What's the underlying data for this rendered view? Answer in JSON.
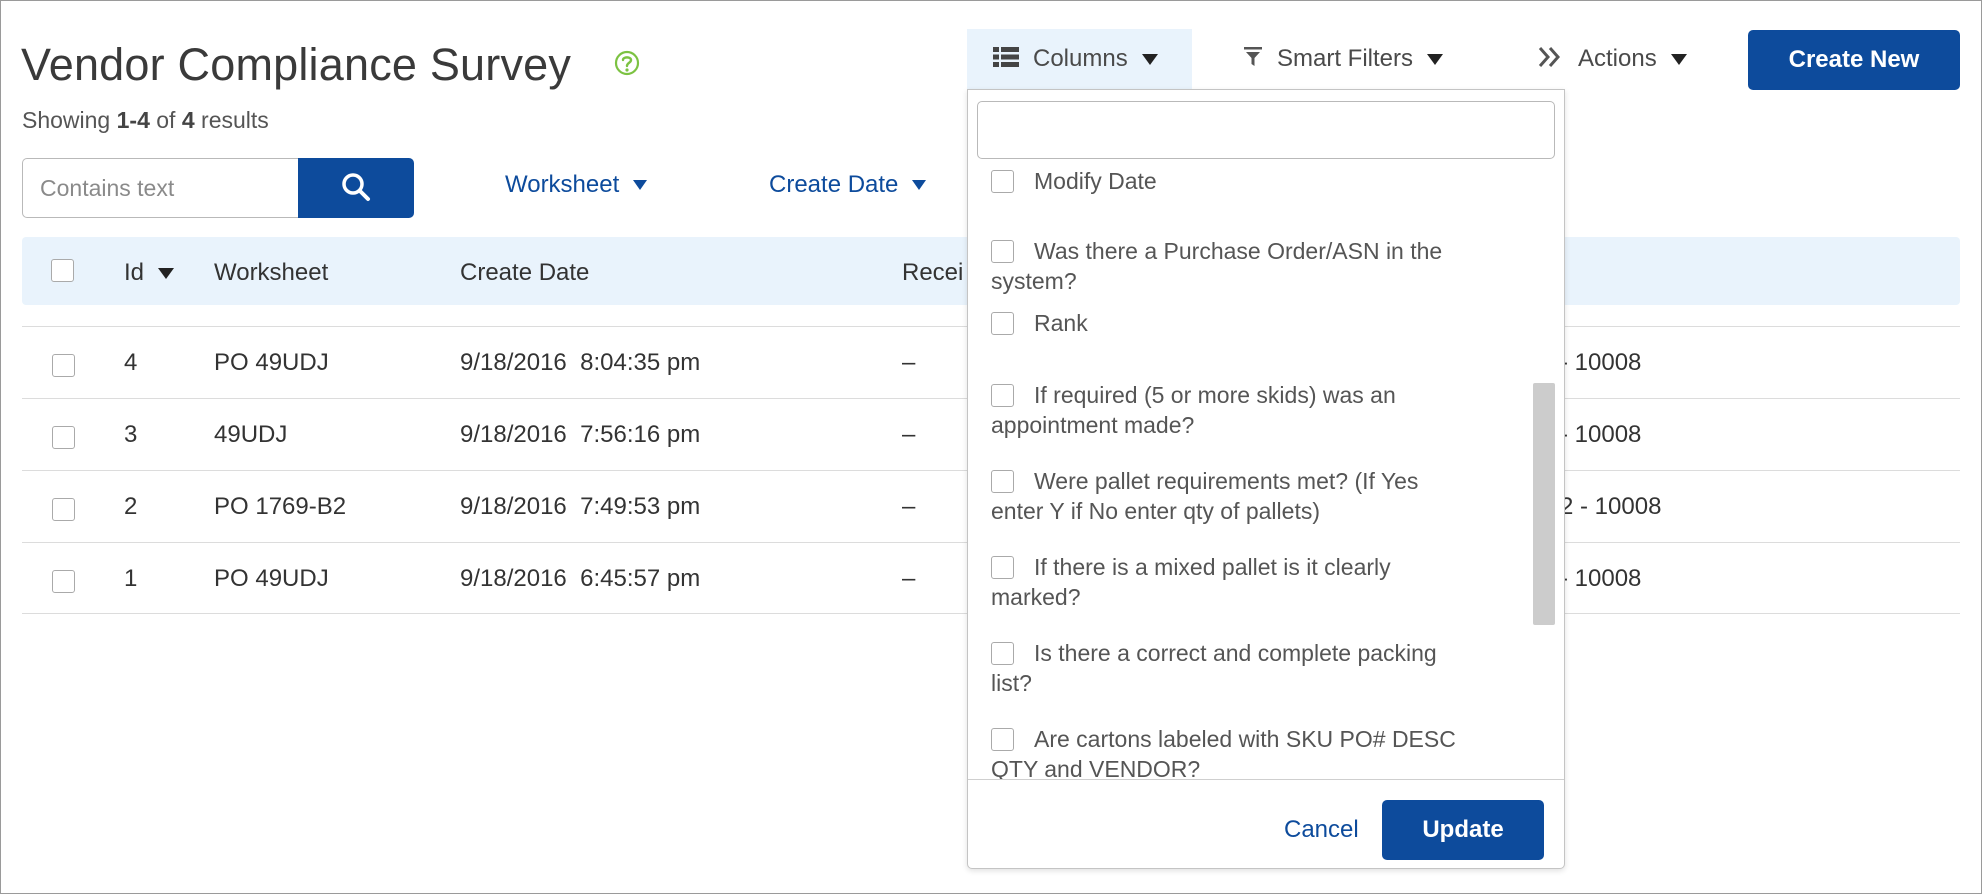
{
  "header": {
    "title": "Vendor Compliance Survey",
    "showing_prefix": "Showing",
    "showing_range": "1-4",
    "showing_of": "of",
    "showing_total": "4",
    "showing_suffix": "results"
  },
  "toolbar": {
    "columns_label": "Columns",
    "smart_filters_label": "Smart Filters",
    "actions_label": "Actions",
    "create_new_label": "Create New"
  },
  "search": {
    "placeholder": "Contains text",
    "value": ""
  },
  "filters": {
    "worksheet_label": "Worksheet",
    "create_date_label": "Create Date"
  },
  "table": {
    "headers": {
      "id": "Id",
      "worksheet": "Worksheet",
      "create_date": "Create Date",
      "received": "Recei"
    },
    "rows": [
      {
        "id": "4",
        "worksheet": "PO 49UDJ",
        "create_date": "9/18/2016  8:04:35 pm",
        "received": "–",
        "right": "- 10008"
      },
      {
        "id": "3",
        "worksheet": "49UDJ",
        "create_date": "9/18/2016  7:56:16 pm",
        "received": "–",
        "right": "- 10008"
      },
      {
        "id": "2",
        "worksheet": "PO 1769-B2",
        "create_date": "9/18/2016  7:49:53 pm",
        "received": "–",
        "right": "2 - 10008"
      },
      {
        "id": "1",
        "worksheet": "PO 49UDJ",
        "create_date": "9/18/2016  6:45:57 pm",
        "received": "–",
        "right": "- 10008"
      }
    ]
  },
  "columns_panel": {
    "search_value": "",
    "options": [
      {
        "line1": "Modify Date",
        "line2": ""
      },
      {
        "line1": "Was there a Purchase Order/ASN in the",
        "line2": "system?"
      },
      {
        "line1": "Rank",
        "line2": ""
      },
      {
        "line1": "If required (5 or more skids) was an",
        "line2": "appointment made?"
      },
      {
        "line1": "Were pallet requirements met? (If Yes",
        "line2": "enter Y if No enter qty of pallets)"
      },
      {
        "line1": "If there is a mixed pallet is it clearly",
        "line2": "marked?"
      },
      {
        "line1": "Is there a correct and complete packing",
        "line2": "list?"
      },
      {
        "line1": "Are cartons labeled with SKU PO# DESC",
        "line2": "QTY and VENDOR?"
      }
    ],
    "cancel_label": "Cancel",
    "update_label": "Update"
  },
  "colors": {
    "primary": "#0d4b9c",
    "header_bg": "#e9f3fc",
    "help_icon": "#7cc242"
  },
  "icons": {
    "help": "question-circle-icon",
    "columns": "list-icon",
    "smart_filters": "filter-icon",
    "actions": "double-chevron-right-icon",
    "search": "magnifier-icon"
  }
}
